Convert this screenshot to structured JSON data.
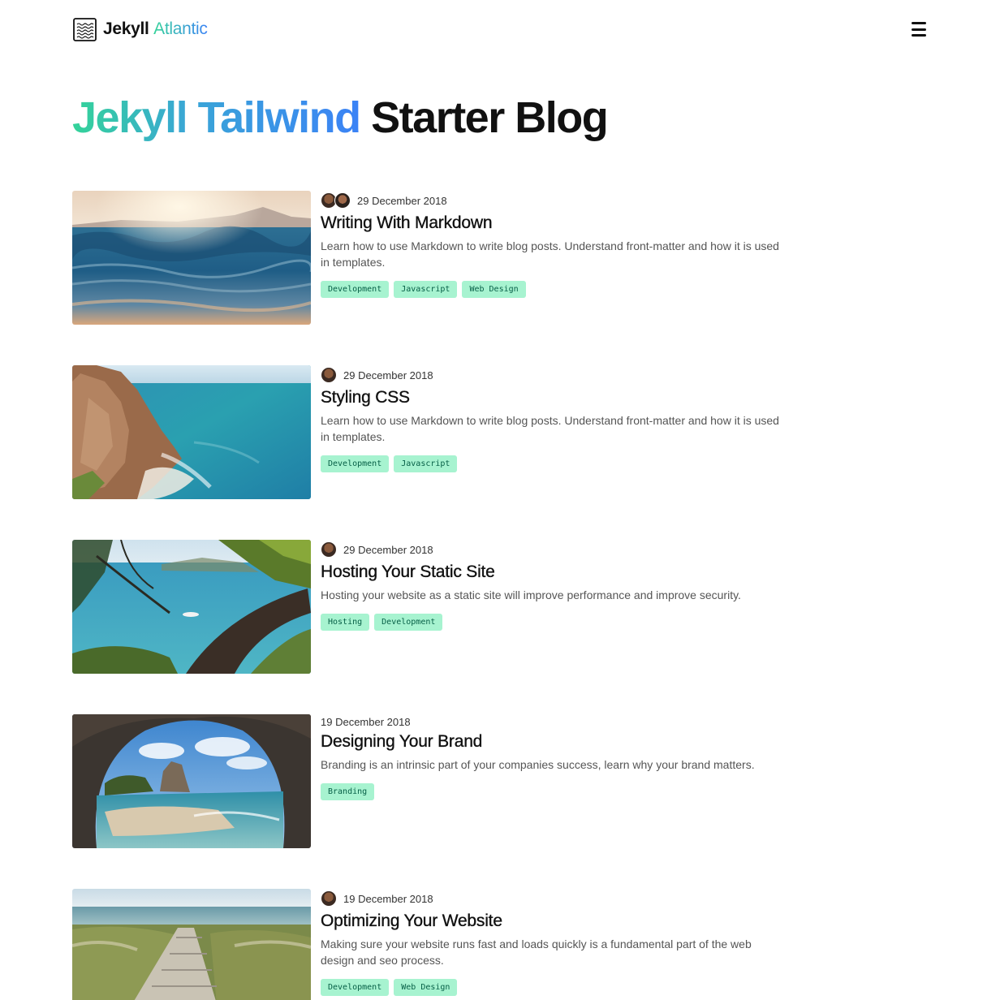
{
  "header": {
    "brand_main": "Jekyll",
    "brand_accent": "Atlantic",
    "logo_icon": "waves-logo-icon",
    "menu_icon": "hamburger-menu-icon"
  },
  "page": {
    "title_gradient": "Jekyll Tailwind",
    "title_plain": "Starter Blog"
  },
  "colors": {
    "tag_bg": "#a7f3d0",
    "tag_text": "#065f46",
    "gradient_start": "#34d399",
    "gradient_end": "#3b82f6"
  },
  "posts": [
    {
      "date": "29 December 2018",
      "title": "Writing With Markdown",
      "excerpt": "Learn how to use Markdown to write blog posts. Understand front-matter and how it is used in templates.",
      "tags": [
        "Development",
        "Javascript",
        "Web Design"
      ],
      "authors": 2,
      "image": "ocean-waves-sunset"
    },
    {
      "date": "29 December 2018",
      "title": "Styling CSS",
      "excerpt": "Learn how to use Markdown to write blog posts. Understand front-matter and how it is used in templates.",
      "tags": [
        "Development",
        "Javascript"
      ],
      "authors": 1,
      "image": "coastal-cliff"
    },
    {
      "date": "29 December 2018",
      "title": "Hosting Your Static Site",
      "excerpt": "Hosting your website as a static site will improve performance and improve security.",
      "tags": [
        "Hosting",
        "Development"
      ],
      "authors": 1,
      "image": "tree-over-bay"
    },
    {
      "date": "19 December 2018",
      "title": "Designing Your Brand",
      "excerpt": "Branding is an intrinsic part of your companies success, learn why your brand matters.",
      "tags": [
        "Branding"
      ],
      "authors": 0,
      "image": "sea-cave-arch"
    },
    {
      "date": "19 December 2018",
      "title": "Optimizing Your Website",
      "excerpt": "Making sure your website runs fast and loads quickly is a fundamental part of the web design and seo process.",
      "tags": [
        "Development",
        "Web Design"
      ],
      "authors": 1,
      "image": "boardwalk-dunes"
    }
  ]
}
